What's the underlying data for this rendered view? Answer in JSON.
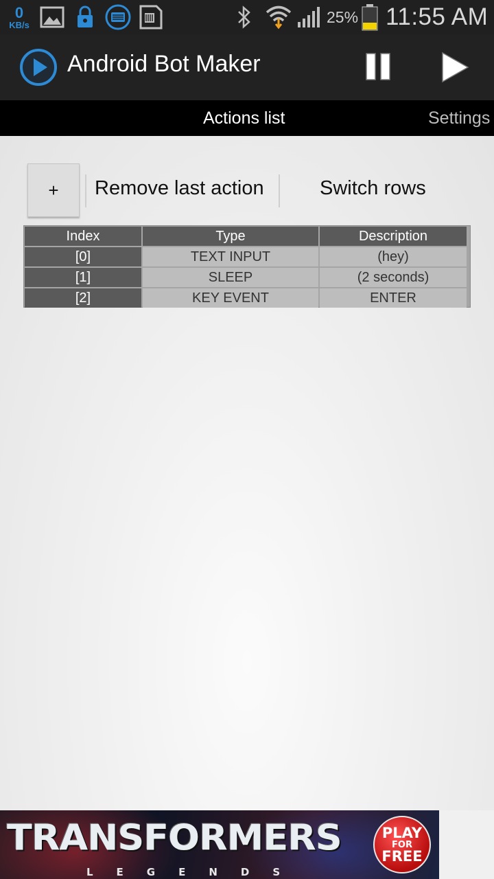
{
  "status_bar": {
    "net_speed_value": "0",
    "net_speed_unit": "KB/s",
    "battery_percent": "25%",
    "time": "11:55 AM"
  },
  "app": {
    "title": "Android Bot Maker"
  },
  "tabs": [
    {
      "label": "Actions list",
      "selected": true
    },
    {
      "label": "Settings",
      "selected": false
    }
  ],
  "toolbar": {
    "add_label": "+",
    "remove_label": "Remove last action",
    "switch_label": "Switch rows"
  },
  "table": {
    "headers": [
      "Index",
      "Type",
      "Description"
    ],
    "rows": [
      [
        "[0]",
        "TEXT INPUT",
        "(hey)"
      ],
      [
        "[1]",
        "SLEEP",
        "(2 seconds)"
      ],
      [
        "[2]",
        "KEY EVENT",
        "ENTER"
      ]
    ]
  },
  "ad": {
    "title": "TRANSFORMERS",
    "subtitle": "LEGENDS",
    "badge": [
      "PLAY",
      "FOR",
      "FREE"
    ]
  },
  "colors": {
    "accent_blue": "#2d8bd6",
    "battery_yellow": "#f2d200",
    "actionbar": "#222222",
    "tabbar": "#000000",
    "table_header": "#5a5a5a",
    "table_cell": "#bdbdbd"
  }
}
